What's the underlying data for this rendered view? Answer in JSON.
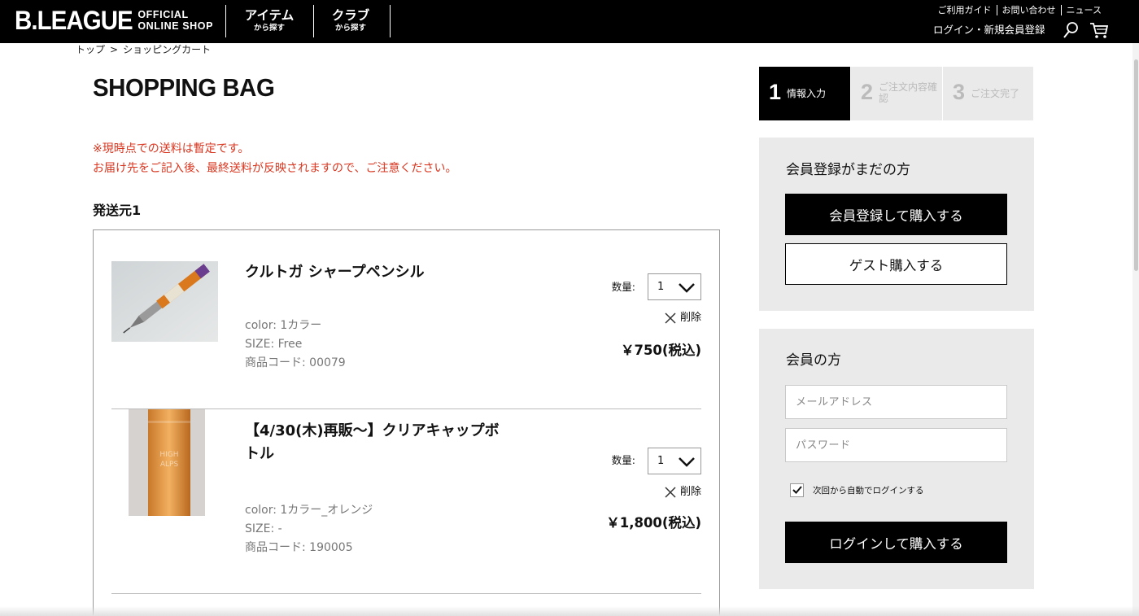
{
  "header": {
    "logo_main": "B.LEAGUE",
    "logo_sub_1": "OFFICIAL",
    "logo_sub_2": "ONLINE SHOP",
    "nav": [
      {
        "main": "アイテム",
        "sub": "から探す"
      },
      {
        "main": "クラブ",
        "sub": "から探す"
      }
    ],
    "util_links": [
      "ご利用ガイド",
      "お問い合わせ",
      "ニュース"
    ],
    "login_register": "ログイン・新規会員登録"
  },
  "breadcrumb": {
    "home": "トップ",
    "sep": ">",
    "current": "ショッピングカート"
  },
  "page_title": "SHOPPING BAG",
  "notice": {
    "line1": "※現時点での送料は暫定です。",
    "line2": "お届け先をご記入後、最終送料が反映されますので、ご注意ください。"
  },
  "ship_from": "発送元1",
  "cart": {
    "qty_label": "数量:",
    "delete_label": "削除",
    "items": [
      {
        "name": "クルトガ シャープペンシル",
        "color": "color: 1カラー",
        "size": "SIZE: Free",
        "code": "商品コード: 00079",
        "qty": "1",
        "price": "￥750(税込)"
      },
      {
        "name": "【4/30(木)再販〜】クリアキャップボトル",
        "color": "color: 1カラー_オレンジ",
        "size": "SIZE: -",
        "code": "商品コード: 190005",
        "qty": "1",
        "price": "￥1,800(税込)"
      }
    ]
  },
  "steps": [
    {
      "num": "1",
      "label": "情報入力",
      "active": true
    },
    {
      "num": "2",
      "label": "ご注文内容確認",
      "active": false
    },
    {
      "num": "3",
      "label": "ご注文完了",
      "active": false
    }
  ],
  "guest_panel": {
    "title": "会員登録がまだの方",
    "register_button": "会員登録して購入する",
    "guest_button": "ゲスト購入する"
  },
  "member_panel": {
    "title": "会員の方",
    "email_placeholder": "メールアドレス",
    "password_placeholder": "パスワード",
    "remember_label": "次回から自動でログインする",
    "remember_checked": true,
    "login_button": "ログインして購入する"
  },
  "colors": {
    "notice": "#d9361f",
    "header_bg": "#000000",
    "panel_bg": "#eaeaea"
  }
}
